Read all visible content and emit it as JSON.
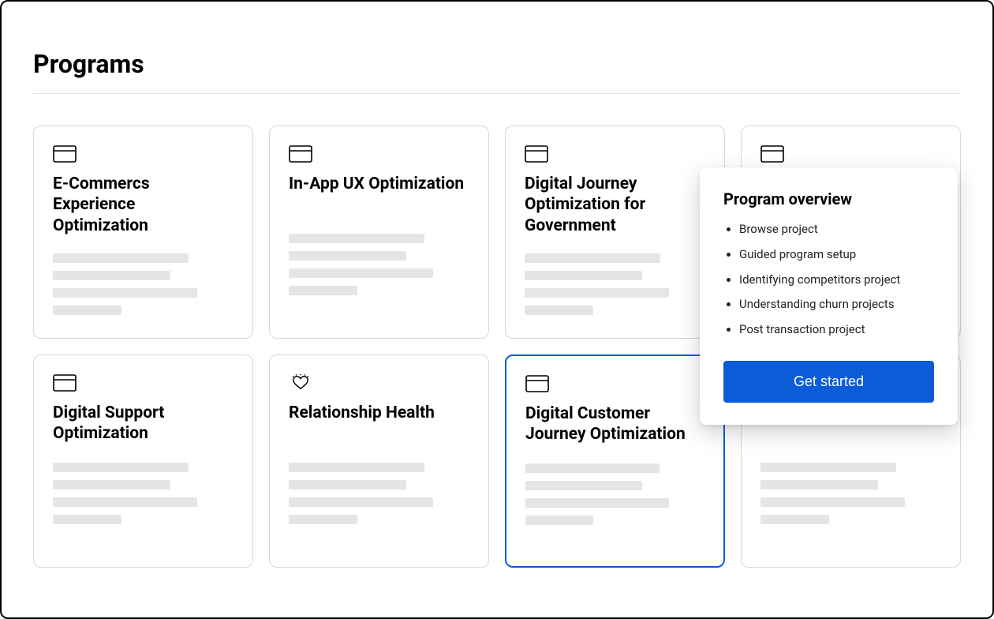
{
  "page": {
    "title": "Programs"
  },
  "colors": {
    "accent": "#0a5cd7"
  },
  "cards": [
    {
      "icon": "card",
      "title": "E-Commercs Experience Optimization"
    },
    {
      "icon": "card",
      "title": "In-App UX Optimization"
    },
    {
      "icon": "card",
      "title": "Digital Journey Optimization for Government"
    },
    {
      "icon": "card",
      "title": ""
    },
    {
      "icon": "card",
      "title": "Digital Support Optimization"
    },
    {
      "icon": "heart",
      "title": "Relationship Health"
    },
    {
      "icon": "card",
      "title": "Digital Customer Journey Optimization",
      "selected": true
    },
    {
      "icon": "card",
      "title": ""
    }
  ],
  "popover": {
    "title": "Program overview",
    "accent": "#0a5cd7",
    "items": [
      "Browse project",
      "Guided program setup",
      "Identifying competitors project",
      "Understanding churn projects",
      "Post transaction project"
    ],
    "cta": "Get started"
  }
}
